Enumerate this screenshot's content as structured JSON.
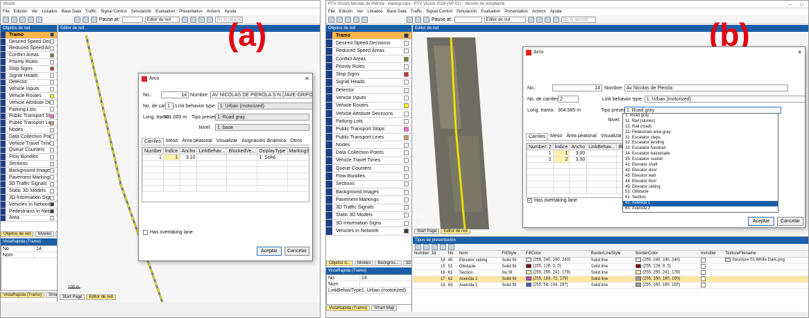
{
  "panel_a": {
    "label": "(a)",
    "title": "Vissim",
    "menu": [
      "File",
      "Edición",
      "Ver",
      "Listados",
      "Base Data",
      "Traffic",
      "Signal Control",
      "Simulación",
      "Evaluation",
      "Presentation",
      "Actions",
      "Ayuda"
    ],
    "toolbar": {
      "pause_at": "Pause at:",
      "editor_mode": "Editor de red",
      "search_placeholder": "Go to second"
    },
    "sidebar_title": "Objetos de red",
    "network_objects": [
      {
        "label": "Tramo",
        "color": "#3a3a3a",
        "selected": true
      },
      {
        "label": "Desired Speed Decisions",
        "color": "#ffffff"
      },
      {
        "label": "Reduced Speed Areas",
        "color": "#ffffff"
      },
      {
        "label": "Conflict Areas",
        "color": "#6b8e23"
      },
      {
        "label": "Priority Rules",
        "color": "#ffffff"
      },
      {
        "label": "Stop Signs",
        "color": "#cc3333"
      },
      {
        "label": "Signal Heads",
        "color": "#ffffff"
      },
      {
        "label": "Detector",
        "color": "#ffffff"
      },
      {
        "label": "Vehicle Inputs",
        "color": "#ffffff"
      },
      {
        "label": "Vehicle Routes",
        "color": "#ffff00"
      },
      {
        "label": "Vehicle Attribute Decisions",
        "color": "#ffffff"
      },
      {
        "label": "Parking Lots",
        "color": "#ffffff"
      },
      {
        "label": "Public Transport Stops",
        "color": "#ff66cc"
      },
      {
        "label": "Public Transport Lines",
        "color": "#cc9966"
      },
      {
        "label": "Nodes",
        "color": "#ffffff"
      },
      {
        "label": "Data Collection Points",
        "color": "#ffffff"
      },
      {
        "label": "Vehicle Travel Times",
        "color": "#ffffff"
      },
      {
        "label": "Queue Counters",
        "color": "#ffffff"
      },
      {
        "label": "Flow Bundles",
        "color": "#ffffff"
      },
      {
        "label": "Sections",
        "color": "#ffffff"
      },
      {
        "label": "Background Images",
        "color": "#ffffff"
      },
      {
        "label": "Pavement Markings",
        "color": "#ffffff"
      },
      {
        "label": "3D Traffic Signals",
        "color": "#ffffff"
      },
      {
        "label": "Static 3D Models",
        "color": "#ffffff"
      },
      {
        "label": "3D Information Signs",
        "color": "#ffffff"
      },
      {
        "label": "Vehicles In Network",
        "color": "#3a3a3a"
      },
      {
        "label": "Pedestrians In Network",
        "color": "#3a3a3a"
      },
      {
        "label": "Area",
        "color": "#ffffff"
      }
    ],
    "sidebar_tabs": [
      "Objetos de red",
      "Niveles",
      "Background",
      "3D inform..."
    ],
    "quickview_title": "VistaRapida (Tramo)",
    "quickview_rows": [
      {
        "k": "No",
        "v": "14"
      },
      {
        "k": "Nom",
        "v": ""
      }
    ],
    "quickview_tabs": [
      "VistaRapida (Tramo)",
      "Smart Map"
    ],
    "map_tab": "Editor de red",
    "scale": "100 m",
    "bottom_tabs": [
      "Start Page",
      "Editor de red"
    ],
    "dialog": {
      "title": "Arco",
      "no_label": "No.:",
      "no_value": "14",
      "name_label": "Nombre:",
      "name_value": "AV NICOLAS DE PIEROLA S-N (JAVE-GRIFO)",
      "lanes_label": "No. de carriles:",
      "lanes_value": "1",
      "behavior_label": "Link behavior type:",
      "behavior_value": "1: Urban (motorized)",
      "length_label": "Long. tramo:",
      "length_value": "301.000 m",
      "present_label": "Tipo present:",
      "present_value": "1: Road gray",
      "level_label": "Nivel:",
      "level_value": "1: base",
      "tabs": [
        "Carriles",
        "Meso",
        "Área peatonal",
        "Visualizar",
        "Asignación dinámica",
        "Otros"
      ],
      "grid_headers": [
        "Number",
        "Índice",
        "Ancho",
        "LinkBehav...",
        "BlockedVe...",
        "DisplayType",
        "MarkingS...",
        "NoLnChLA...",
        "NoLnChR...",
        "NoLnChA...",
        "NoLnChR..."
      ],
      "grid_rows": [
        [
          "1",
          "1",
          "3.10",
          "",
          "",
          "1: Solid..",
          "",
          "",
          "",
          "",
          ""
        ]
      ],
      "overtaking": "Has overtaking lane",
      "ok": "Aceptar",
      "cancel": "Cancelar"
    }
  },
  "panel_b": {
    "label": "(b)",
    "title": "PTV Vissim Nicolás de Piérola - backup.inpx - PTV Vissim 2024 (SP 01) - Versión de estudiante",
    "menu": [
      "File",
      "Edición",
      "Ver",
      "Listados",
      "Base Data",
      "Traffic",
      "Signal Control",
      "Simulación",
      "Evaluation",
      "Presentation",
      "Actions",
      "Ayuda"
    ],
    "toolbar": {
      "pause_at": "Pause at:",
      "editor_mode": "Editor de red",
      "search_placeholder": "Go to second"
    },
    "sidebar_title": "Objetos de red",
    "network_objects": [
      {
        "label": "Tramo",
        "color": "#3a3a3a",
        "selected": true
      },
      {
        "label": "Desired Speed Decisions",
        "color": "#ffffff"
      },
      {
        "label": "Reduced Speed Areas",
        "color": "#ffffff"
      },
      {
        "label": "Conflict Areas",
        "color": "#6b8e23"
      },
      {
        "label": "Priority Rules",
        "color": "#ffffff"
      },
      {
        "label": "Stop Signs",
        "color": "#cc3333"
      },
      {
        "label": "Signal Heads",
        "color": "#ffffff"
      },
      {
        "label": "Detector",
        "color": "#ffffff"
      },
      {
        "label": "Vehicle Inputs",
        "color": "#ffffff"
      },
      {
        "label": "Vehicle Routes",
        "color": "#ffff00"
      },
      {
        "label": "Vehicle Attribute Decisions",
        "color": "#ffffff"
      },
      {
        "label": "Parking Lots",
        "color": "#ffffff"
      },
      {
        "label": "Public Transport Stops",
        "color": "#ff66cc"
      },
      {
        "label": "Public Transport Lines",
        "color": "#cc9966"
      },
      {
        "label": "Nodes",
        "color": "#ffffff"
      },
      {
        "label": "Data Collection Points",
        "color": "#ffffff"
      },
      {
        "label": "Vehicle Travel Times",
        "color": "#ffffff"
      },
      {
        "label": "Queue Counters",
        "color": "#ffffff"
      },
      {
        "label": "Flow Bundles",
        "color": "#ffffff"
      },
      {
        "label": "Sections",
        "color": "#ffffff"
      },
      {
        "label": "Background Images",
        "color": "#ffffff"
      },
      {
        "label": "Pavement Markings",
        "color": "#ffffff"
      },
      {
        "label": "3D Traffic Signals",
        "color": "#ffffff"
      },
      {
        "label": "Static 3D Models",
        "color": "#ffffff"
      },
      {
        "label": "3D Information Signs",
        "color": "#ffffff"
      },
      {
        "label": "Vehicles In Network",
        "color": "#3a3a3a"
      }
    ],
    "sidebar_tabs": [
      "Objetos d...",
      "Niveles",
      "Backgrou...",
      "3D inform..."
    ],
    "quickview_title": "VistaRapida (Tramo)",
    "quickview_rows": [
      {
        "k": "No",
        "v": "14"
      },
      {
        "k": "Nom",
        "v": ""
      },
      {
        "k": "LinkBehavType",
        "v": "1: Urban (motorized)"
      }
    ],
    "quickview_tabs": [
      "VistaRapida (Tramo)",
      "Smart Map"
    ],
    "map_tab": "Editor de red",
    "scale": "200 m",
    "bottom_tabs": [
      "Start Page",
      "Editor de red"
    ],
    "dialog": {
      "title": "Arco",
      "no_label": "No.:",
      "no_value": "14",
      "name_label": "Nombre:",
      "name_value": "Av Nicolas de Pierola",
      "lanes_label": "No. de carriles:",
      "lanes_value": "2",
      "behavior_label": "Link behavior type:",
      "behavior_value": "1: Urban (motorized)",
      "length_label": "Long. tramo:",
      "length_value": "304.585 m",
      "present_label": "Tipo present:",
      "present_value": "1: Road gray",
      "level_label": "Nivel:",
      "tabs": [
        "Carriles",
        "Meso",
        "Área peatonal",
        "Visualizar",
        "Asignación"
      ],
      "grid_headers": [
        "Number: 2",
        "Índice",
        "Ancho",
        "LinkBehav...",
        "Blc"
      ],
      "grid_rows": [
        [
          "1",
          "1",
          "3.00",
          "",
          ""
        ],
        [
          "2",
          "2",
          "3.00",
          "",
          ""
        ]
      ],
      "overtaking": "Has overtaking lane",
      "ok": "Aceptar",
      "cancel": "Cancelar",
      "dropdown_options": [
        "1: Road gray",
        "11: Rail (stones)",
        "12: Rail (road)",
        "21: Pedestrian area gray",
        "31: Escalator steps",
        "32: Escalator landing",
        "33: Escalator handrail",
        "34: Escalator balustrade",
        "35: Escalator socket",
        "41: Elevator shaft",
        "42: Elevator door",
        "43: Elevator wall",
        "44: Elevator floor",
        "45: Elevator ceiling",
        "51: Obstacle",
        "61: Section",
        "62: Avenida 1",
        "63: Avenida 2"
      ],
      "dropdown_highlight": "62: Avenida 1"
    },
    "pres_title": "Tipos de presentación",
    "pres_headers": [
      "Number: 18",
      "No",
      "Nom",
      "FillStyle",
      "FillColor",
      "BorderLineStyle",
      "BorderColor",
      "Invisible",
      "TextureFilename"
    ],
    "pres_rows": [
      {
        "n": "14",
        "no": "45",
        "nom": "Elevator ceiling",
        "fs": "Solid fill",
        "fc": "(255, 240, 240, 240)",
        "fcx": "#f0f0f0",
        "bls": "Solid line",
        "bc": "(255, 240, 240, 240)",
        "bcx": "#f0f0f0",
        "tex": "Structure 01 White Dark.png"
      },
      {
        "n": "15",
        "no": "51",
        "nom": "Obstacle",
        "fs": "Solid fill",
        "fc": "(255, 128, 0, 0)",
        "fcx": "#800000",
        "bls": "Solid line",
        "bc": "(255, 128, 0, 0)",
        "bcx": "#800000",
        "tex": ""
      },
      {
        "n": "16",
        "no": "61",
        "nom": "Section",
        "fs": "No fill",
        "fc": "(255, 255, 241, 178)",
        "fcx": "#fff1b2",
        "bls": "Solid line",
        "bc": "(255, 255, 241, 178)",
        "bcx": "#fff1b2",
        "tex": ""
      },
      {
        "n": "17",
        "no": "62",
        "nom": "Avenida 1",
        "fs": "Solid fill",
        "fc": "(255, 183, 72, 179)",
        "fcx": "#b748b3",
        "bls": "Solid line",
        "bc": "(255, 160, 160, 160)",
        "bcx": "#a0a0a0",
        "tex": "",
        "sel": true
      },
      {
        "n": "18",
        "no": "63",
        "nom": "Avenida 2",
        "fs": "Solid fill",
        "fc": "(255, 58, 104, 197)",
        "fcx": "#3a68c5",
        "bls": "Solid line",
        "bc": "(255, 160, 160, 160)",
        "bcx": "#a0a0a0",
        "tex": ""
      }
    ]
  }
}
